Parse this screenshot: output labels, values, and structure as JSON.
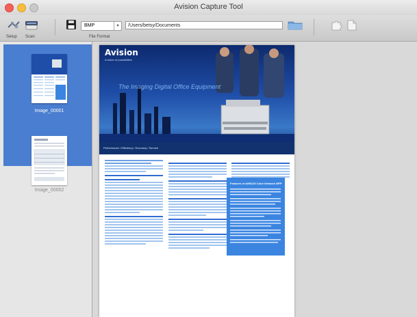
{
  "window": {
    "title": "Avision Capture Tool"
  },
  "toolbar": {
    "setup_label": "Setup",
    "scan_label": "Scan",
    "file_format_label": "File Format",
    "format_value": "BMP",
    "path_value": "/Users/betsy/Documents"
  },
  "sidebar": {
    "items": [
      {
        "label": "Image_00001",
        "selected": true
      },
      {
        "label": "Image_00002",
        "selected": false
      }
    ]
  },
  "document": {
    "brand": "Avision",
    "brand_tagline": "A vision of possibilities",
    "headline": "The Imaging Digital Office Equipment",
    "tagline": "Performance / Efficiency / Economy / Service",
    "feature_title": "Features of AM6120 Color Network MFP"
  },
  "colors": {
    "selection": "#4a7ed0",
    "feature_box": "#3b85e0"
  }
}
